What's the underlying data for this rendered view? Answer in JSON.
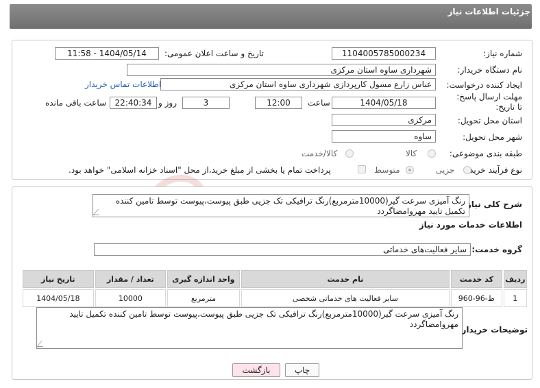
{
  "header": {
    "title": "جزئیات اطلاعات نیاز"
  },
  "form": {
    "need_number_label": "شماره نیاز:",
    "need_number": "1104005785000234",
    "announce_label": "تاریخ و ساعت اعلان عمومی:",
    "announce_value": "1404/05/14 - 11:58",
    "buyer_org_label": "نام دستگاه خریدار:",
    "buyer_org": "شهرداری ساوه استان مرکزی",
    "creator_label": "ایجاد کننده درخواست:",
    "creator": "عباس زارع مسول کارپردازی شهرداری ساوه استان مرکزی",
    "contact_link": "اطلاعات تماس خریدار",
    "deadline_label": "مهلت ارسال پاسخ: تا تاریخ:",
    "deadline_date": "1404/05/18",
    "time_label": "ساعت",
    "deadline_time": "12:00",
    "days_value": "3",
    "days_label": "روز و",
    "remaining_time": "22:40:34",
    "remaining_label": "ساعت باقی مانده",
    "province_label": "استان محل تحویل:",
    "province": "مرکزی",
    "city_label": "شهر محل تحویل:",
    "city": "ساوه",
    "category_label": "طبقه بندی موضوعی:",
    "category_options": [
      "کالا",
      "کالا/خدمت"
    ],
    "process_label": "نوع فرآیند خرید :",
    "process_options": [
      "جزیی",
      "متوسط"
    ],
    "payment_note": "پرداخت تمام یا بخشی از مبلغ خرید،از محل \"اسناد خزانه اسلامی\" خواهد بود."
  },
  "summary": {
    "label": "شرح کلی نیاز:",
    "text": "رنگ آمیزی سرعت گیر(10000مترمربع)رنگ ترافیکی تک جزیی طبق پیوست،پیوست توسط تامین کننده تکمیل تایید مهروامضاگردد"
  },
  "services": {
    "section_title": "اطلاعات خدمات مورد نیاز",
    "group_label": "گروه خدمت:",
    "group_value": "سایر فعالیت‌های خدماتی",
    "columns": [
      "ردیف",
      "کد خدمت",
      "نام خدمت",
      "واحد اندازه گیری",
      "تعداد / مقدار",
      "تاریخ نیاز"
    ],
    "rows": [
      {
        "row": "1",
        "code": "ط-96-960",
        "name": "سایر فعالیت های خدماتی شخصی",
        "unit": "مترمربع",
        "qty": "10000",
        "date": "1404/05/18"
      }
    ]
  },
  "buyer_notes": {
    "label": "توضیحات خریدار:",
    "text": "رنگ آمیزی سرعت گیر(10000مترمربع)رنگ ترافیکی تک جزیی طبق پیوست،پیوست توسط تامین کننده تکمیل تایید مهروامضاگردد"
  },
  "buttons": {
    "print": "چاپ",
    "back": "بازگشت"
  },
  "watermark": {
    "text": "AriaTender.neT"
  },
  "colors": {
    "header_bg": "#7d7d7d",
    "link": "#1a5fb4",
    "back_button_bg": "#ffe3ea",
    "watermark": "#c0392b"
  }
}
